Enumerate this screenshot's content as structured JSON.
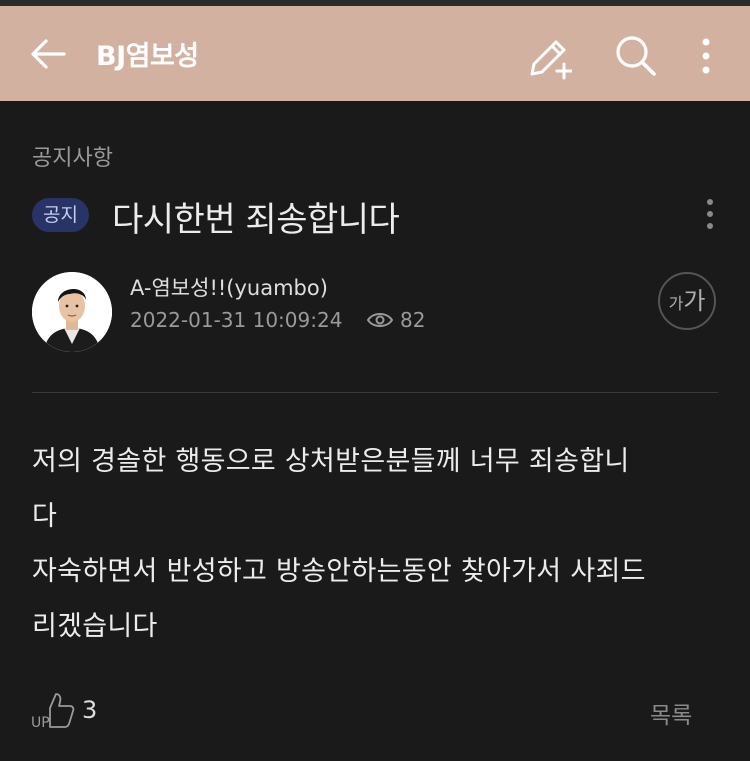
{
  "header": {
    "title": "BJ염보성",
    "icons": [
      "arrow-left-icon",
      "pencil-plus-icon",
      "search-icon",
      "kebab-icon"
    ],
    "background": "#d2b1a1"
  },
  "post": {
    "board": "공지사항",
    "badge": "공지",
    "title": "다시한번 죄송합니다",
    "author": "A-염보성!!(yuambo)",
    "date": "2022-01-31 10:09:24",
    "views": "82",
    "font_size_label_small": "가",
    "font_size_label_big": "가",
    "content_lines": [
      "저의 경솔한 행동으로 상처받은분들께 너무 죄송합니",
      "다",
      "자숙하면서 반성하고 방송안하는동안 찾아가서 사죄드",
      "리겠습니다"
    ]
  },
  "footer": {
    "up_label": "UP",
    "up_count": "3",
    "list_label": "목록"
  },
  "colors": {
    "background": "#1a1a1a",
    "badge_bg": "#283466",
    "badge_text": "#c6cdf4"
  }
}
